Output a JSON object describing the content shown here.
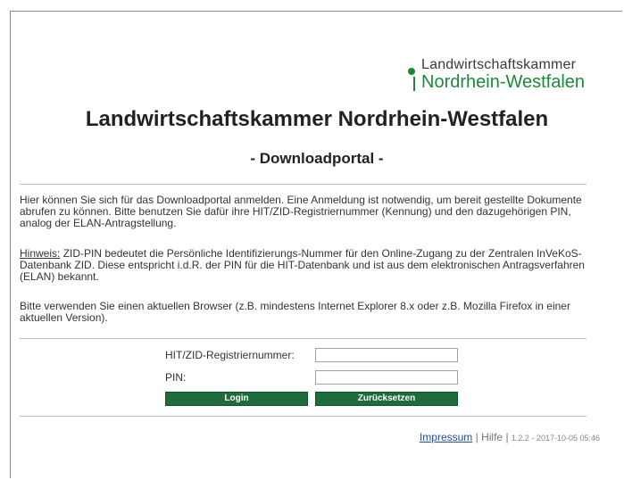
{
  "logo": {
    "line1": "Landwirtschaftskammer",
    "line2": "Nordrhein-Westfalen"
  },
  "header": {
    "title": "Landwirtschaftskammer Nordrhein-Westfalen",
    "subtitle": "- Downloadportal -"
  },
  "intro": {
    "text": "Hier können Sie sich für das Downloadportal anmelden. Eine Anmeldung ist notwendig, um bereit gestellte Dokumente abrufen zu können. Bitte benutzen Sie dafür ihre HIT/ZID-Registriernummer (Kennung) und den dazugehörigen PIN, analog der ELAN-Antragstellung."
  },
  "hint": {
    "label": "Hinweis:",
    "text": " ZID-PIN bedeutet die Persönliche Identifizierungs-Nummer für den Online-Zugang zu der Zentralen InVeKoS-Datenbank ZID. Diese entspricht i.d.R. der PIN für die HIT-Datenbank und ist aus dem elektronischen Antragsverfahren (ELAN) bekannt."
  },
  "browser_note": {
    "text": "Bitte verwenden Sie einen aktuellen Browser (z.B. mindestens Internet Explorer 8.x oder z.B. Mozilla Firefox in einer aktuellen Version)."
  },
  "form": {
    "reg_label": "HIT/ZID-Registriernummer:",
    "reg_value": "",
    "pin_label": "PIN:",
    "pin_value": "",
    "login_label": "Login",
    "reset_label": "Zurücksetzen"
  },
  "footer": {
    "impressum": "Impressum",
    "separator": "|",
    "hilfe": "Hilfe",
    "separator2": "|",
    "version": "1.2.2 - 2017-10-05 05:46"
  },
  "colors": {
    "brand_green": "#1a8a3a",
    "button_green": "#1e6b3c",
    "link_blue": "#1f4e9a"
  }
}
